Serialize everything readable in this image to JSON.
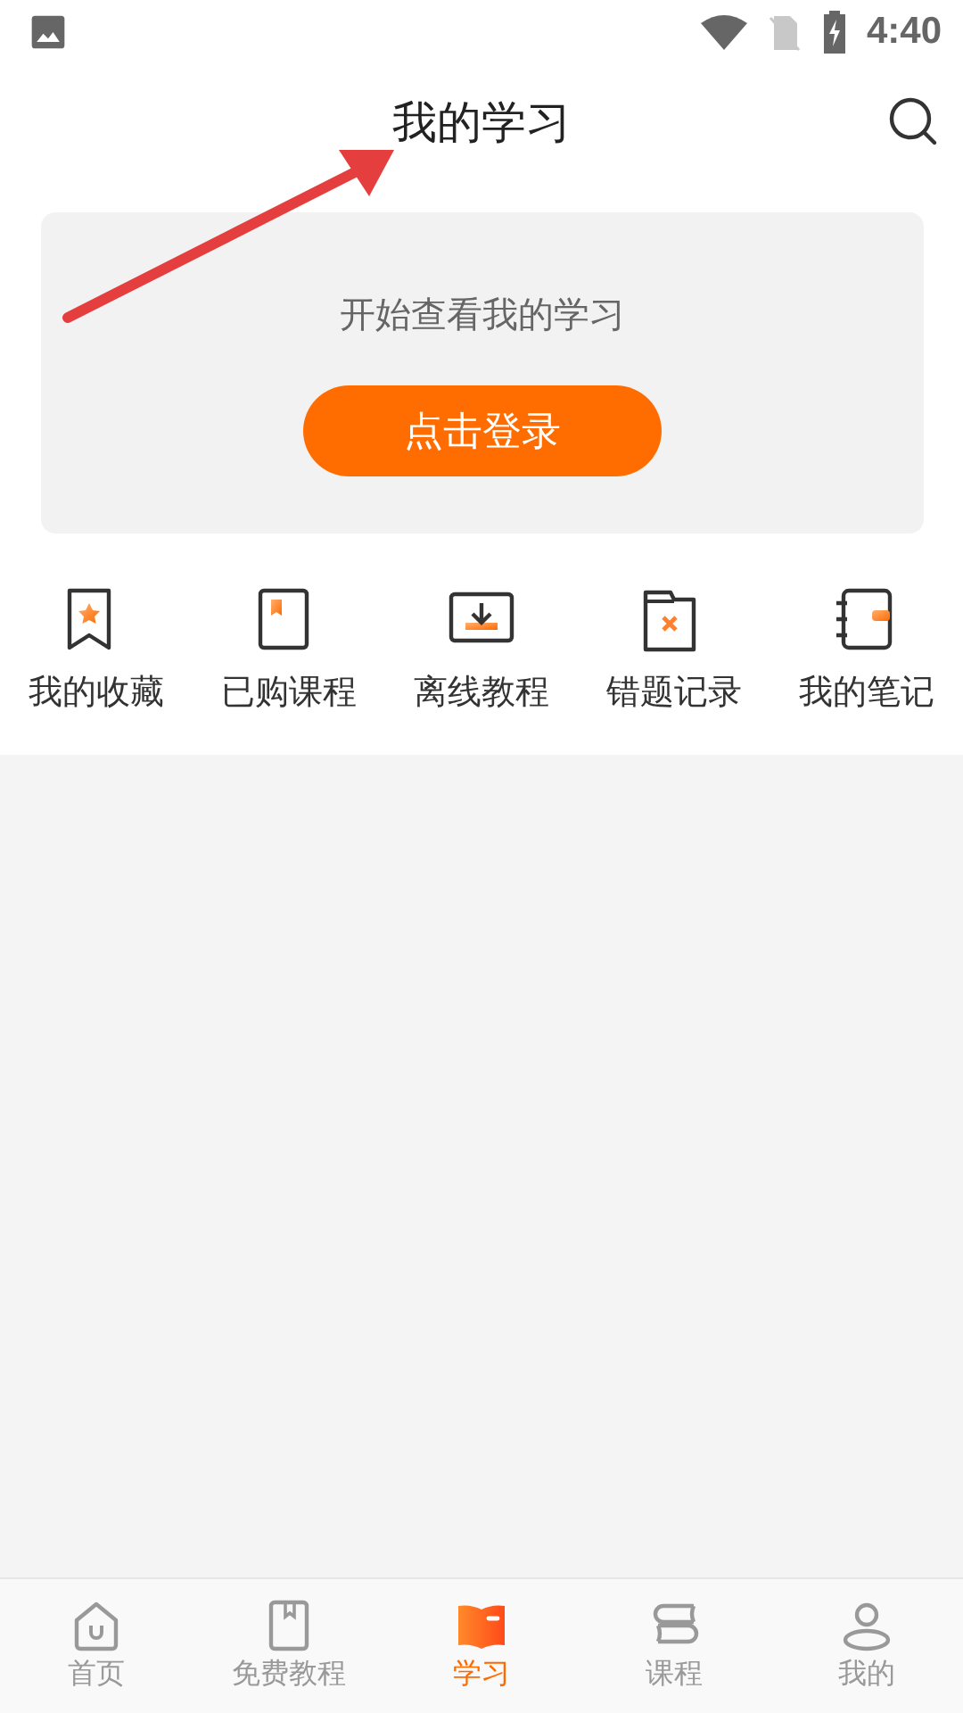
{
  "status_bar": {
    "time": "4:40"
  },
  "header": {
    "title": "我的学习"
  },
  "login_card": {
    "prompt": "开始查看我的学习",
    "button": "点击登录"
  },
  "shortcuts": [
    {
      "label": "我的收藏"
    },
    {
      "label": "已购课程"
    },
    {
      "label": "离线教程"
    },
    {
      "label": "错题记录"
    },
    {
      "label": "我的笔记"
    }
  ],
  "bottom_nav": [
    {
      "label": "首页",
      "selected": false
    },
    {
      "label": "免费教程",
      "selected": false
    },
    {
      "label": "学习",
      "selected": true
    },
    {
      "label": "课程",
      "selected": false
    },
    {
      "label": "我的",
      "selected": false
    }
  ]
}
